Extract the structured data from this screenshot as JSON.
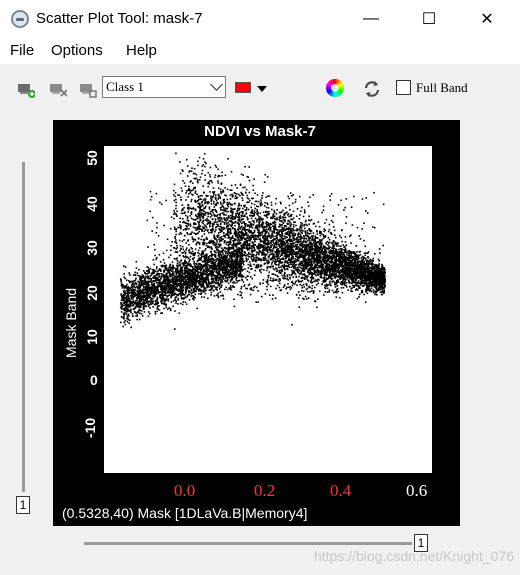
{
  "window": {
    "title": "Scatter Plot Tool: mask-7",
    "minimize": "—",
    "maximize": "☐",
    "close": "✕"
  },
  "menu": [
    "File",
    "Options",
    "Help"
  ],
  "toolbar": {
    "class_value": "Class 1",
    "class_color": "#ff0000",
    "full_band_label": "Full Band",
    "full_band_checked": false
  },
  "plot": {
    "title": "NDVI vs Mask-7",
    "ylabel": "Mask Band",
    "y_ticks": [
      "50",
      "40",
      "30",
      "20",
      "10",
      "0",
      "-10"
    ],
    "x_ticks": [
      "0.0",
      "0.2",
      "0.4",
      "0.6"
    ],
    "status": "(0.5328,40) Mask [1DLaVa.B|Memory4]"
  },
  "slider": {
    "vertical_value": "1",
    "horizontal_value": "1"
  },
  "watermark": "https://blog.csdn.net/Knight_076",
  "chart_data": {
    "type": "scatter",
    "title": "NDVI vs Mask-7",
    "xlabel": "",
    "ylabel": "Mask Band",
    "xlim": [
      0.0,
      0.62
    ],
    "ylim": [
      -13,
      53
    ],
    "grid": false,
    "clusters": [
      {
        "name": "upper band",
        "x_range": [
          0.12,
          0.53
        ],
        "y_center": 38,
        "spread": 8
      },
      {
        "name": "lower band",
        "x_range": [
          0.02,
          0.24
        ],
        "y_center": 26,
        "spread": 4
      }
    ]
  }
}
